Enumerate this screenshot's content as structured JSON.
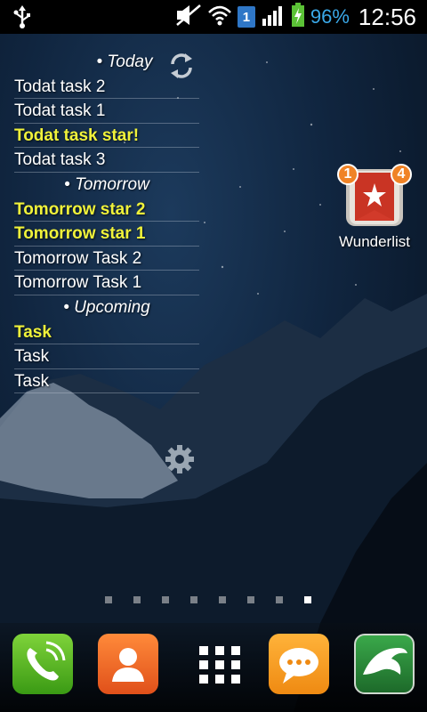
{
  "status_bar": {
    "battery_percent": "96%",
    "clock": "12:56",
    "notification_badge": "1",
    "icons": [
      "usb-icon",
      "mute-icon",
      "wifi-icon",
      "sim-badge-icon",
      "signal-icon",
      "battery-charging-icon"
    ]
  },
  "widget": {
    "rows": [
      {
        "text": "• Today",
        "type": "header"
      },
      {
        "text": "Todat task 2",
        "type": "task"
      },
      {
        "text": "Todat task 1",
        "type": "task"
      },
      {
        "text": "Todat task star!",
        "type": "star"
      },
      {
        "text": "Todat task 3",
        "type": "task"
      },
      {
        "text": "• Tomorrow",
        "type": "header"
      },
      {
        "text": "Tomorrow star 2",
        "type": "star"
      },
      {
        "text": "Tomorrow star 1",
        "type": "star"
      },
      {
        "text": "Tomorrow Task 2",
        "type": "task"
      },
      {
        "text": "Tomorrow Task 1",
        "type": "task"
      },
      {
        "text": "• Upcoming",
        "type": "header"
      },
      {
        "text": "Task",
        "type": "star"
      },
      {
        "text": "Task",
        "type": "task"
      },
      {
        "text": "Task",
        "type": "task"
      }
    ],
    "sync_icon": "refresh-icon"
  },
  "wunderlist": {
    "label": "Wunderlist",
    "badge_left": "1",
    "badge_right": "4"
  },
  "settings_icon": "gear-icon",
  "pager": {
    "pages": 8,
    "active_index": 7
  },
  "dock": {
    "items": [
      "phone-icon",
      "contacts-icon",
      "app-drawer-icon",
      "messaging-icon",
      "dolphin-browser-icon"
    ]
  },
  "colors": {
    "star_task": "#f0f23a",
    "battery_text": "#3aa8e8"
  }
}
